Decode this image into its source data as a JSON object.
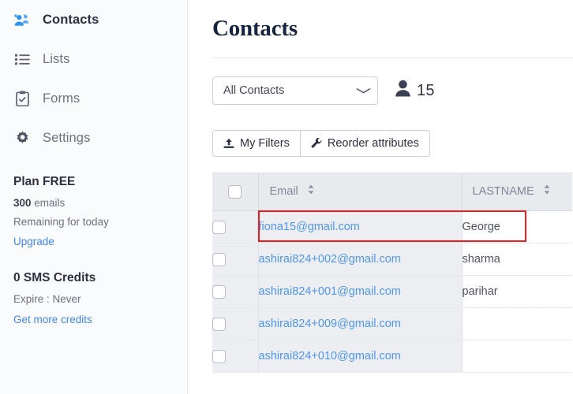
{
  "sidebar": {
    "nav_items": [
      {
        "label": "Contacts",
        "icon": "users-group-icon",
        "active": true
      },
      {
        "label": "Lists",
        "icon": "list-icon",
        "active": false
      },
      {
        "label": "Forms",
        "icon": "clipboard-check-icon",
        "active": false
      },
      {
        "label": "Settings",
        "icon": "gear-icon",
        "active": false
      }
    ],
    "plan": {
      "title": "Plan FREE",
      "emails_count": "300",
      "emails_word": " emails",
      "remaining": "Remaining for today",
      "upgrade_link": "Upgrade"
    },
    "sms": {
      "title": "0 SMS Credits",
      "expire": "Expire : Never",
      "credits_link": "Get more credits"
    }
  },
  "main": {
    "page_title": "Contacts",
    "contact_filter": {
      "selected": "All Contacts",
      "options": [
        "All Contacts"
      ],
      "chevron": "chevron-down-icon"
    },
    "contact_count": "15",
    "buttons": [
      {
        "label": "My Filters",
        "icon": "upload-icon"
      },
      {
        "label": "Reorder attributes",
        "icon": "wrench-icon"
      }
    ],
    "table": {
      "columns": [
        {
          "key": "checkbox",
          "label": ""
        },
        {
          "key": "email",
          "label": "Email",
          "sortable": true
        },
        {
          "key": "lastname",
          "label": "LASTNAME",
          "sortable": true
        }
      ],
      "rows": [
        {
          "email": "fiona15@gmail.com",
          "lastname": "George",
          "highlighted": true
        },
        {
          "email": "ashirai824+002@gmail.com",
          "lastname": "sharma",
          "highlighted": false
        },
        {
          "email": "ashirai824+001@gmail.com",
          "lastname": "parihar",
          "highlighted": false
        },
        {
          "email": "ashirai824+009@gmail.com",
          "lastname": "",
          "highlighted": false
        },
        {
          "email": "ashirai824+010@gmail.com",
          "lastname": "",
          "highlighted": false
        }
      ]
    }
  },
  "colors": {
    "accent_blue": "#4f96f5",
    "link_blue": "#4285f4",
    "title_navy": "#16243f",
    "highlight_red": "#ee1c1c",
    "header_grey": "#e8eaee",
    "column_grey": "#edeef2"
  }
}
